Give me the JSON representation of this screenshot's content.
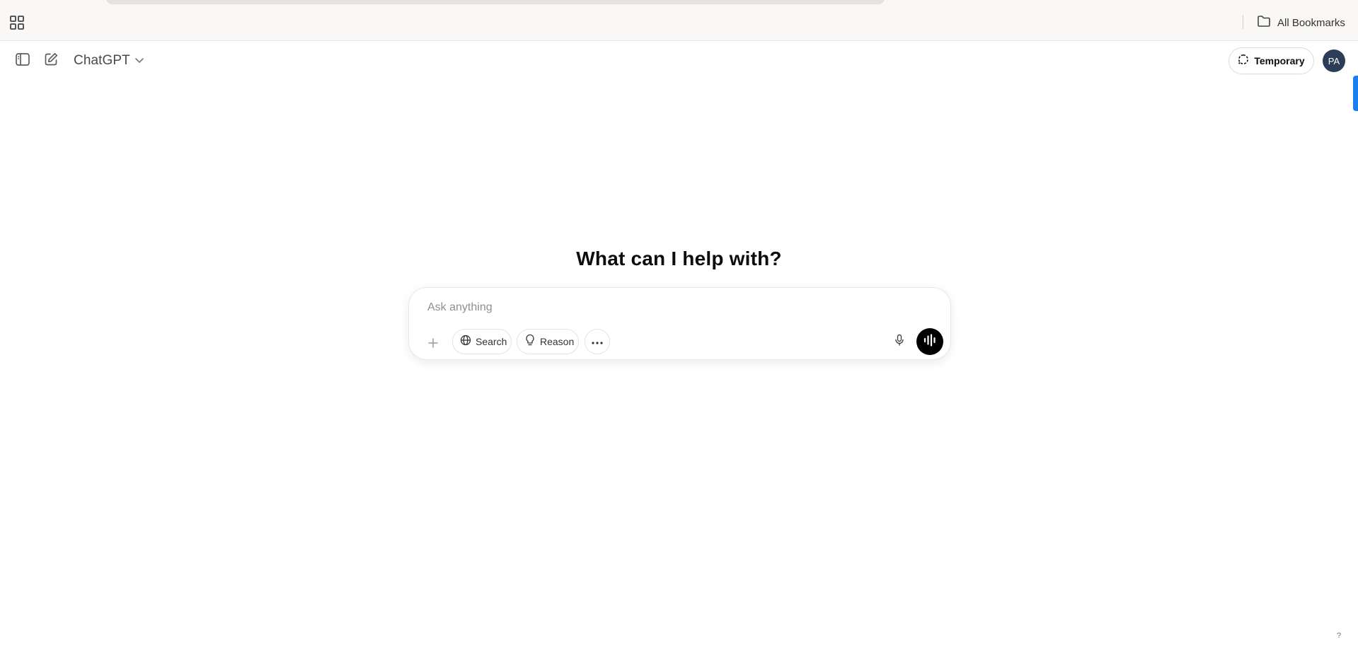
{
  "browser": {
    "bookmarks_label": "All Bookmarks",
    "icons": {
      "apps": "apps-grid-icon",
      "bookmarks": "folder-icon"
    }
  },
  "header": {
    "model_name": "ChatGPT",
    "temporary_label": "Temporary",
    "avatar_initials": "PA",
    "icons": {
      "sidebar_toggle": "sidebar-toggle-icon",
      "new_chat": "edit-icon",
      "model_dropdown": "chevron-down-icon",
      "temporary": "dashed-chat-bubble-icon"
    }
  },
  "main": {
    "title": "What can I help with?",
    "composer": {
      "placeholder": "Ask anything",
      "value": "",
      "tools": {
        "search_label": "Search",
        "reason_label": "Reason"
      },
      "icons": {
        "attach": "plus-icon",
        "search": "globe-icon",
        "reason": "lightbulb-icon",
        "more": "ellipsis-icon",
        "dictate": "microphone-icon",
        "voice": "voice-waveform-icon"
      }
    }
  },
  "footer": {
    "help_label": "?"
  },
  "colors": {
    "browser_bar": "#f9f8f6",
    "avatar_bg": "#2c3e57",
    "voice_button": "#000000",
    "edge_tab": "#1a7ff0"
  }
}
